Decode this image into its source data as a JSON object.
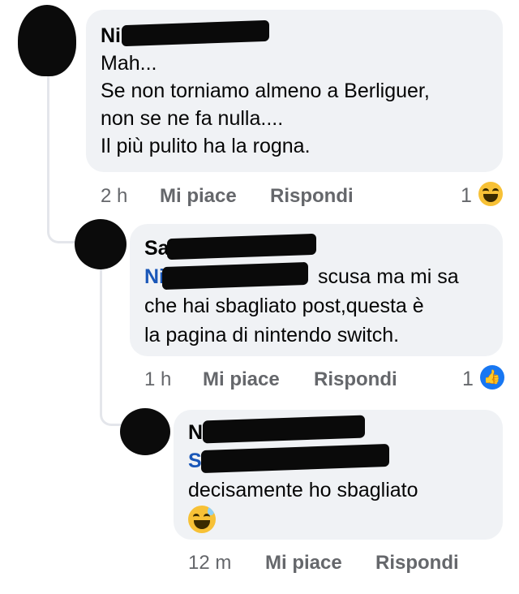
{
  "comments": [
    {
      "author": "Ni",
      "text_lines": [
        "Mah...",
        "Se non torniamo almeno a Berliguer,",
        "non se ne fa nulla....",
        "Il più pulito ha la rogna."
      ],
      "time": "2 h",
      "like_label": "Mi piace",
      "reply_label": "Rispondi",
      "reaction_count": "1",
      "reaction_icon": "haha-emoji-icon"
    },
    {
      "author": "Sa",
      "mention": "Ni",
      "text_lines": [
        "scusa ma mi sa",
        "che hai sbagliato post,questa è",
        "la pagina di nintendo switch."
      ],
      "time": "1 h",
      "like_label": "Mi piace",
      "reply_label": "Rispondi",
      "reaction_count": "1",
      "reaction_icon": "like-thumb-icon"
    },
    {
      "author": "N",
      "mention": "S",
      "text_lines": [
        "decisamente ho sbagliato"
      ],
      "emoji": "grinning-sweat-emoji-icon",
      "time": "12 m",
      "like_label": "Mi piace",
      "reply_label": "Rispondi"
    }
  ],
  "colors": {
    "bubble": "#f0f2f5",
    "mention": "#1a57b8",
    "meta": "#65676b",
    "like": "#1877f2"
  }
}
